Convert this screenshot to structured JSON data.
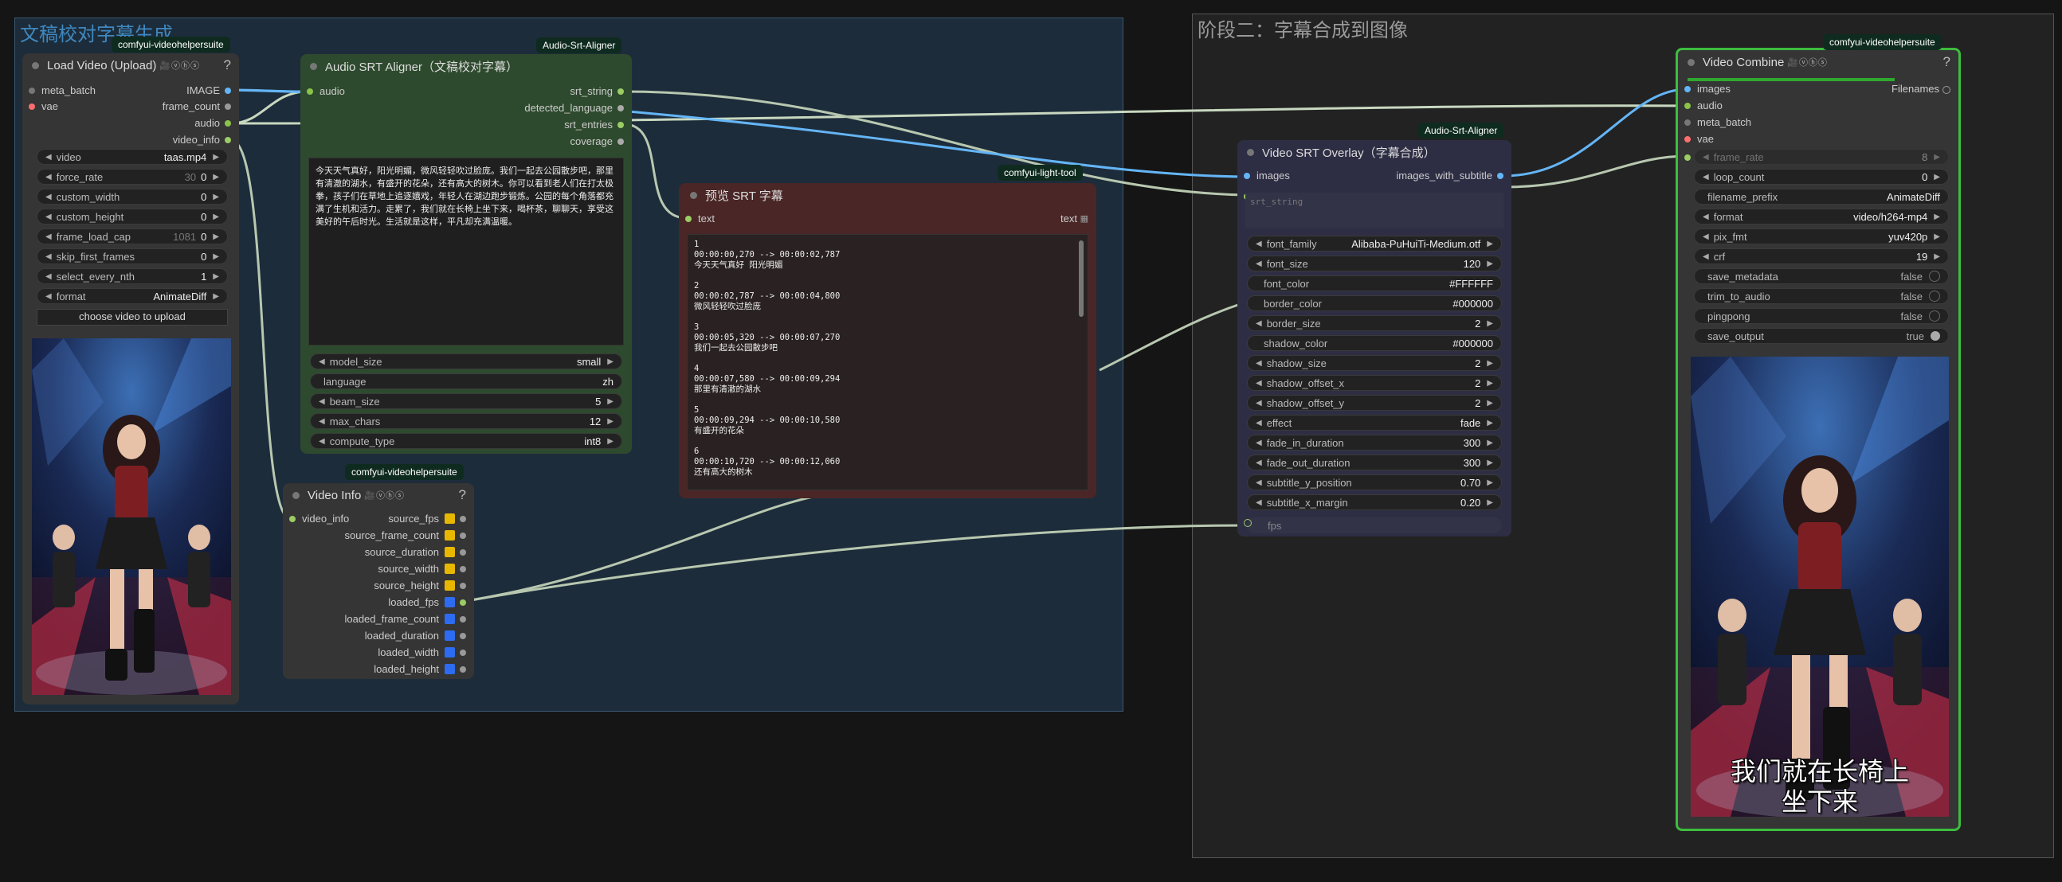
{
  "groups": {
    "stage1_title": "文稿校对字幕生成",
    "stage2_title": "阶段二：字幕合成到图像"
  },
  "load_video": {
    "badge": "comfyui-videohelpersuite",
    "title": "Load Video (Upload)",
    "help": "?",
    "inputs": [
      "meta_batch",
      "vae"
    ],
    "outputs": [
      "IMAGE",
      "frame_count",
      "audio",
      "video_info"
    ],
    "widgets": [
      {
        "label": "video",
        "value": "taas.mp4"
      },
      {
        "label": "force_rate",
        "value": "0",
        "hint": "30"
      },
      {
        "label": "custom_width",
        "value": "0"
      },
      {
        "label": "custom_height",
        "value": "0"
      },
      {
        "label": "frame_load_cap",
        "value": "0",
        "hint": "1081"
      },
      {
        "label": "skip_first_frames",
        "value": "0"
      },
      {
        "label": "select_every_nth",
        "value": "1"
      },
      {
        "label": "format",
        "value": "AnimateDiff"
      }
    ],
    "upload_button": "choose video to upload"
  },
  "aligner": {
    "badge": "Audio-Srt-Aligner",
    "title": "Audio SRT Aligner（文稿校对字幕）",
    "inputs": [
      "audio"
    ],
    "outputs": [
      "srt_string",
      "detected_language",
      "srt_entries",
      "coverage"
    ],
    "script": "今天天气真好，阳光明媚，微风轻轻吹过脸庞。我们一起去公园散步吧，那里有清澈的湖水，有盛开的花朵，还有高大的树木。你可以看到老人们在打太极拳，孩子们在草地上追逐嬉戏，年轻人在湖边跑步锻炼。公园的每个角落都充满了生机和活力。走累了，我们就在长椅上坐下来，喝杯茶，聊聊天，享受这美好的午后时光。生活就是这样，平凡却充满温暖。",
    "widgets": [
      {
        "label": "model_size",
        "value": "small"
      },
      {
        "label": "language",
        "value": "zh"
      },
      {
        "label": "beam_size",
        "value": "5"
      },
      {
        "label": "max_chars",
        "value": "12"
      },
      {
        "label": "compute_type",
        "value": "int8"
      }
    ]
  },
  "video_info": {
    "badge": "comfyui-videohelpersuite",
    "title": "Video Info",
    "help": "?",
    "inputs": [
      "video_info"
    ],
    "outputs": [
      "source_fps",
      "source_frame_count",
      "source_duration",
      "source_width",
      "source_height",
      "loaded_fps",
      "loaded_frame_count",
      "loaded_duration",
      "loaded_width",
      "loaded_height"
    ]
  },
  "preview": {
    "badge": "comfyui-light-tool",
    "title": "预览 SRT 字幕",
    "input": "text",
    "output": "text",
    "entries": [
      {
        "index": "1",
        "time": "00:00:00,270 --> 00:00:02,787",
        "text": "今天天气真好 阳光明媚"
      },
      {
        "index": "2",
        "time": "00:00:02,787 --> 00:00:04,800",
        "text": "微风轻轻吹过脸庞"
      },
      {
        "index": "3",
        "time": "00:00:05,320 --> 00:00:07,270",
        "text": "我们一起去公园散步吧"
      },
      {
        "index": "4",
        "time": "00:00:07,580 --> 00:00:09,294",
        "text": "那里有清澈的湖水"
      },
      {
        "index": "5",
        "time": "00:00:09,294 --> 00:00:10,580",
        "text": "有盛开的花朵"
      },
      {
        "index": "6",
        "time": "00:00:10,720 --> 00:00:12,060",
        "text": "还有高大的树木"
      }
    ]
  },
  "overlay": {
    "badge": "Audio-Srt-Aligner",
    "title": "Video SRT Overlay（字幕合成）",
    "inputs": [
      "images",
      "srt_string"
    ],
    "outputs": [
      "images_with_subtitle"
    ],
    "widgets": [
      {
        "label": "font_family",
        "value": "Alibaba-PuHuiTi-Medium.otf"
      },
      {
        "label": "font_size",
        "value": "120"
      },
      {
        "label": "font_color",
        "value": "#FFFFFF"
      },
      {
        "label": "border_color",
        "value": "#000000"
      },
      {
        "label": "border_size",
        "value": "2"
      },
      {
        "label": "shadow_color",
        "value": "#000000"
      },
      {
        "label": "shadow_size",
        "value": "2"
      },
      {
        "label": "shadow_offset_x",
        "value": "2"
      },
      {
        "label": "shadow_offset_y",
        "value": "2"
      },
      {
        "label": "effect",
        "value": "fade"
      },
      {
        "label": "fade_in_duration",
        "value": "300"
      },
      {
        "label": "fade_out_duration",
        "value": "300"
      },
      {
        "label": "subtitle_y_position",
        "value": "0.70"
      },
      {
        "label": "subtitle_x_margin",
        "value": "0.20"
      }
    ],
    "fps_input": "fps"
  },
  "combine": {
    "badge": "comfyui-videohelpersuite",
    "title": "Video Combine",
    "help": "?",
    "inputs": [
      "images",
      "audio",
      "meta_batch",
      "vae"
    ],
    "output": "Filenames",
    "widgets": [
      {
        "label": "frame_rate",
        "value": "8"
      },
      {
        "label": "loop_count",
        "value": "0"
      },
      {
        "label": "filename_prefix",
        "value": "AnimateDiff"
      },
      {
        "label": "format",
        "value": "video/h264-mp4"
      },
      {
        "label": "pix_fmt",
        "value": "yuv420p"
      },
      {
        "label": "crf",
        "value": "19"
      },
      {
        "label": "save_metadata",
        "value": "false"
      },
      {
        "label": "trim_to_audio",
        "value": "false"
      },
      {
        "label": "pingpong",
        "value": "false"
      },
      {
        "label": "save_output",
        "value": "true"
      }
    ],
    "subtitle_line1": "我们就在长椅上",
    "subtitle_line2": "坐下来"
  },
  "vhs_tag": "🎥ⓥⓗⓢ",
  "colors": {
    "image_slot": "#64b5f6",
    "audio_slot": "#8bc34a",
    "info_slot": "#9ccc65",
    "vae_slot": "#ff6e6e",
    "accent_green": "#3dbd3d",
    "yellow_slot": "#e8b800",
    "blue_slot": "#2d6cf0"
  }
}
